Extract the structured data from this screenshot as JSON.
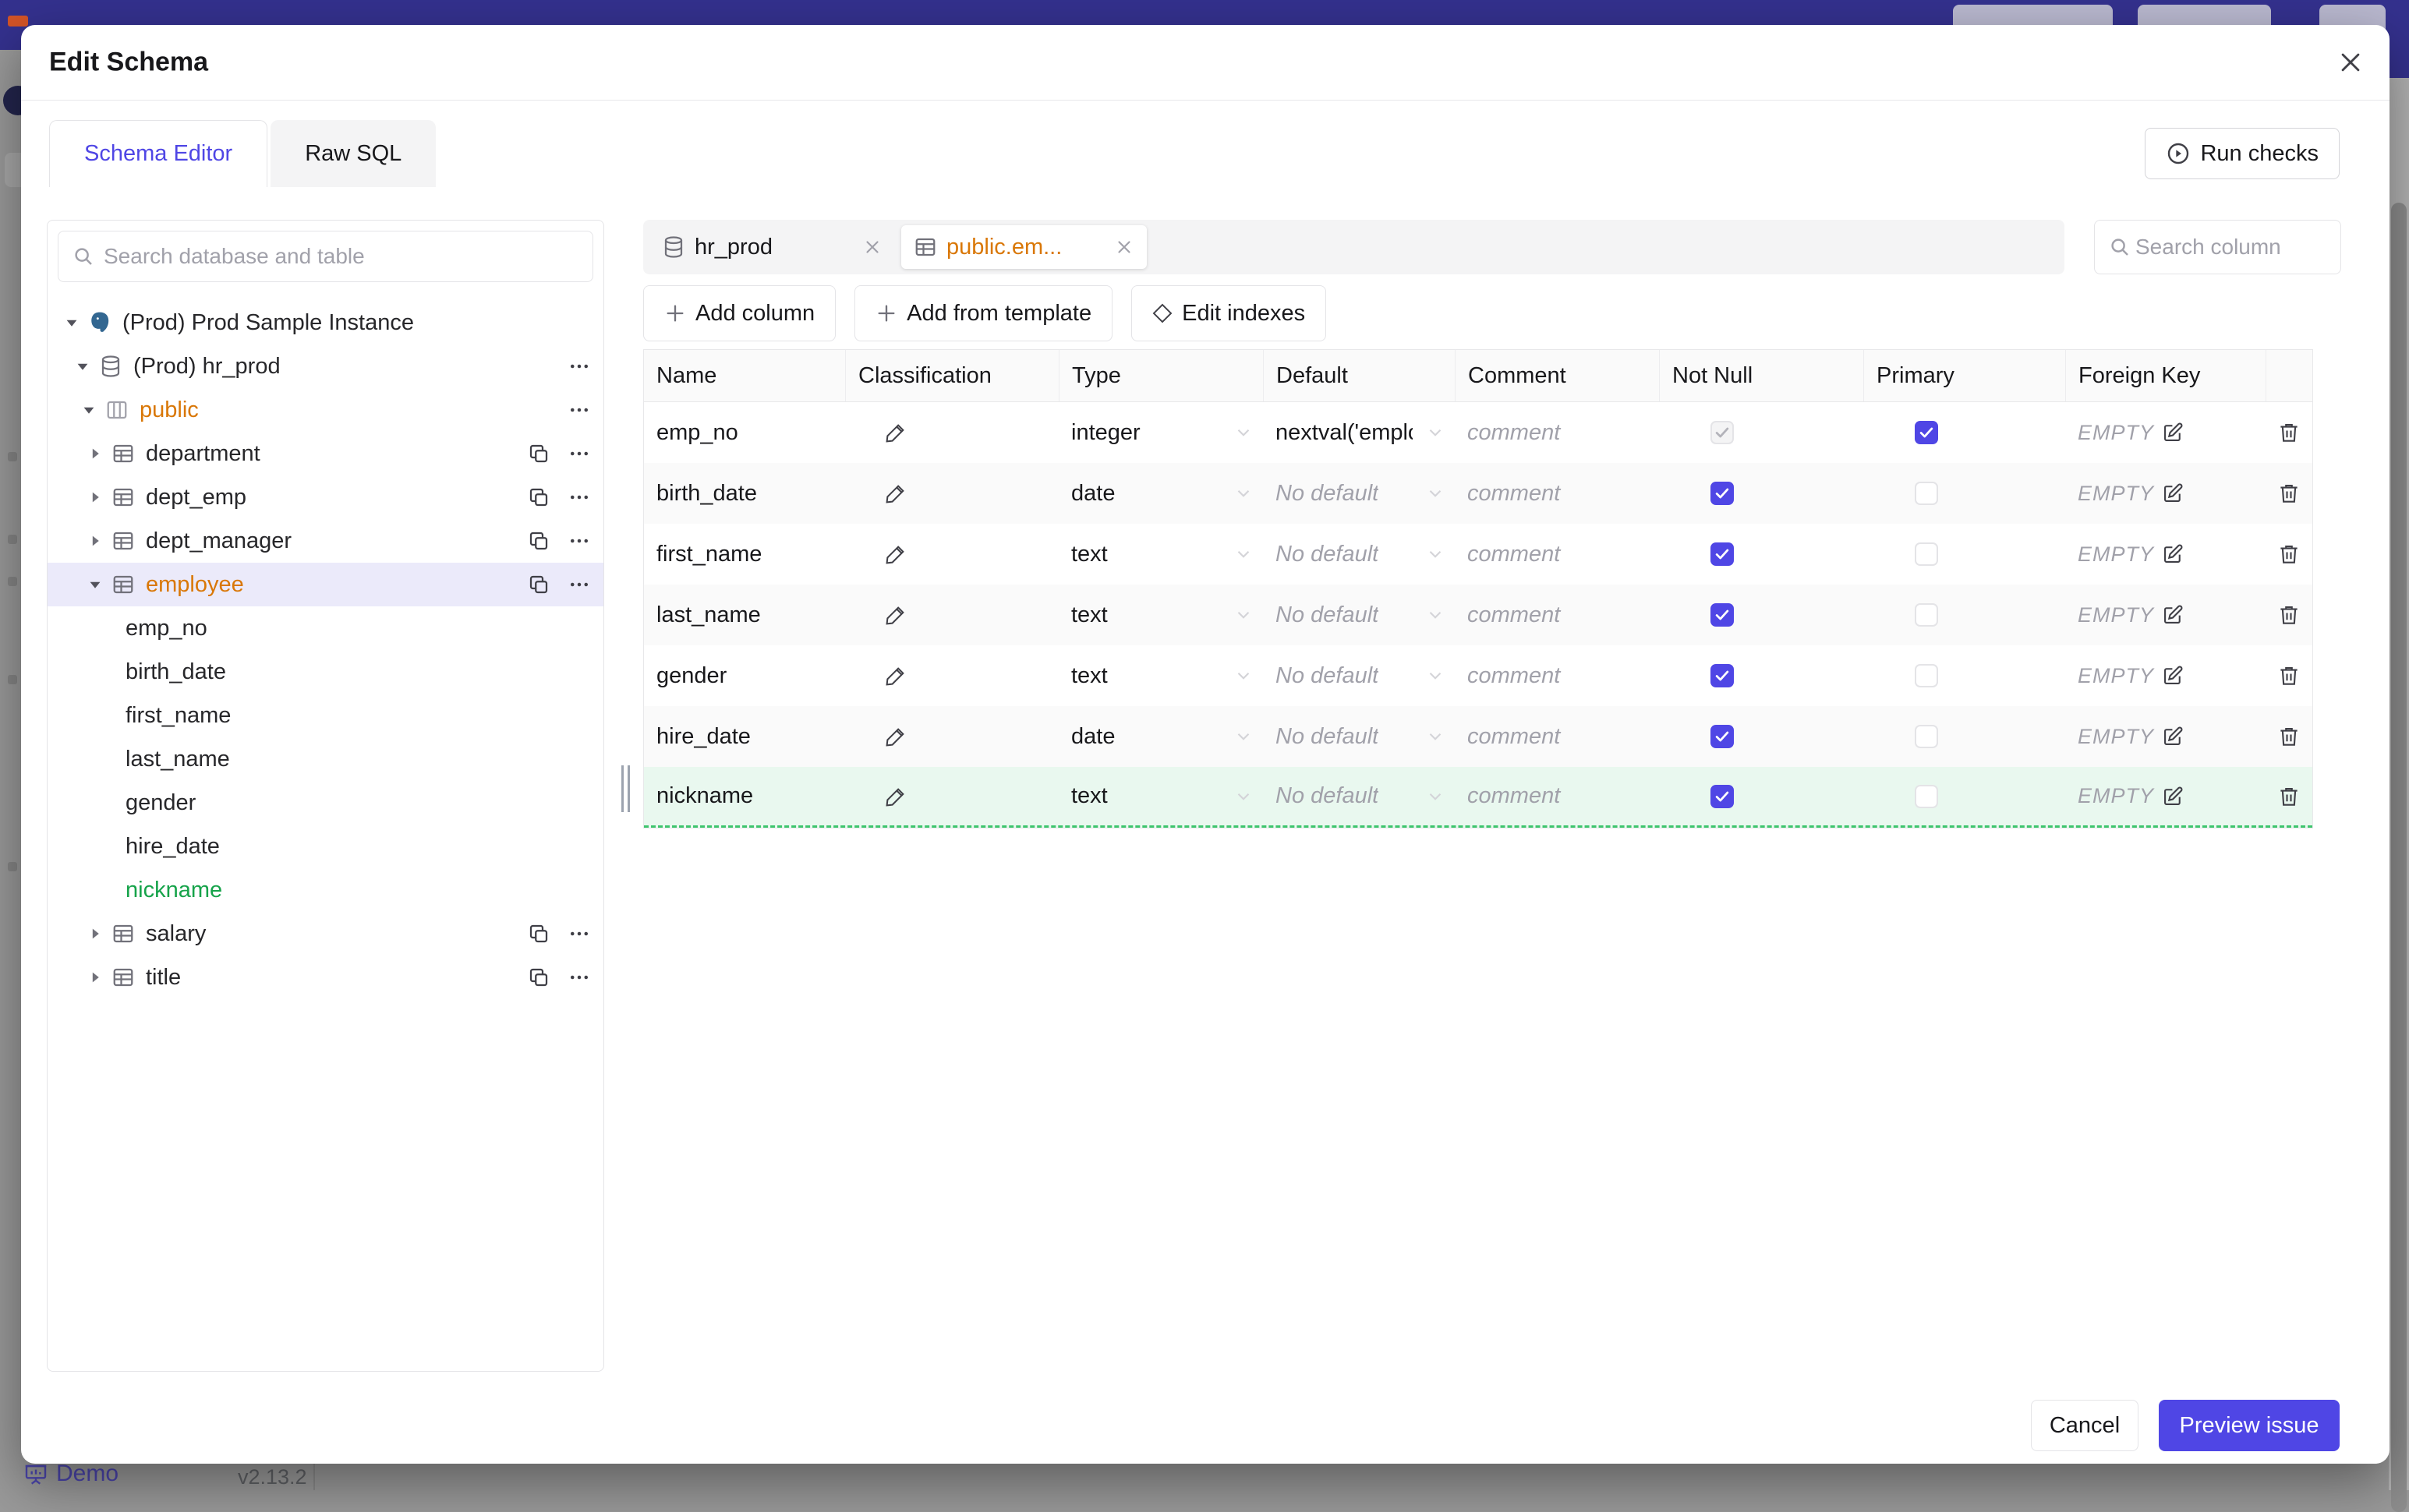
{
  "page": {
    "demo": "Demo",
    "version": "v2.13.2"
  },
  "colors": {
    "accent": "#4f46e5",
    "schema_orange": "#d97706",
    "new_green": "#16a34a",
    "navbar": "#34318e"
  },
  "modal": {
    "title": "Edit Schema",
    "tabs": [
      {
        "label": "Schema Editor"
      },
      {
        "label": "Raw SQL"
      }
    ],
    "run_checks": "Run checks",
    "sidebar": {
      "search_placeholder": "Search database and table",
      "tree": [
        {
          "label": "(Prod) Prod Sample Instance"
        },
        {
          "label": "(Prod) hr_prod"
        },
        {
          "label": "public"
        },
        {
          "label": "department"
        },
        {
          "label": "dept_emp"
        },
        {
          "label": "dept_manager"
        },
        {
          "label": "employee"
        },
        {
          "label": "emp_no"
        },
        {
          "label": "birth_date"
        },
        {
          "label": "first_name"
        },
        {
          "label": "last_name"
        },
        {
          "label": "gender"
        },
        {
          "label": "hire_date"
        },
        {
          "label": "nickname"
        },
        {
          "label": "salary"
        },
        {
          "label": "title"
        }
      ]
    },
    "editor": {
      "tabs": [
        {
          "label": "hr_prod"
        },
        {
          "label": "public.em..."
        }
      ],
      "search_placeholder": "Search column",
      "buttons": {
        "add_column": "Add column",
        "add_from_template": "Add from template",
        "edit_indexes": "Edit indexes"
      },
      "table": {
        "headers": [
          "Name",
          "Classification",
          "Type",
          "Default",
          "Comment",
          "Not Null",
          "Primary",
          "Foreign Key"
        ],
        "comment_placeholder": "comment",
        "fk_label": "EMPTY",
        "rows": [
          {
            "name": "emp_no",
            "type": "integer",
            "default": "nextval('employ"
          },
          {
            "name": "birth_date",
            "type": "date",
            "default": "No default"
          },
          {
            "name": "first_name",
            "type": "text",
            "default": "No default"
          },
          {
            "name": "last_name",
            "type": "text",
            "default": "No default"
          },
          {
            "name": "gender",
            "type": "text",
            "default": "No default"
          },
          {
            "name": "hire_date",
            "type": "date",
            "default": "No default"
          },
          {
            "name": "nickname",
            "type": "text",
            "default": "No default"
          }
        ]
      }
    },
    "footer": {
      "cancel": "Cancel",
      "submit": "Preview issue"
    }
  }
}
